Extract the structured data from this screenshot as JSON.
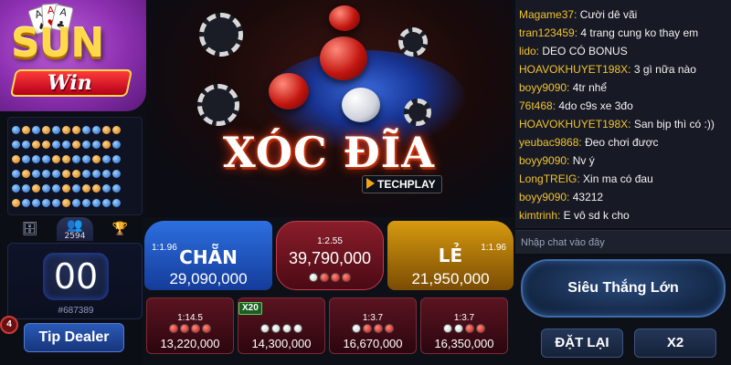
{
  "logo": {
    "brand": "SUN",
    "sub": "Win"
  },
  "colors": {
    "chan": "#2d6fe0",
    "le": "#d79a10",
    "mid": "#8a1d2a",
    "side": "#5a1420",
    "username": "#f2c230"
  },
  "history": {
    "rows": [
      [
        "b",
        "o",
        "b",
        "o",
        "b",
        "o",
        "o",
        "b",
        "b",
        "o",
        "o"
      ],
      [
        "b",
        "b",
        "o",
        "o",
        "b",
        "b",
        "o",
        "b",
        "b",
        "o",
        "b"
      ],
      [
        "o",
        "b",
        "b",
        "b",
        "o",
        "o",
        "b",
        "b",
        "o",
        "b",
        "b"
      ],
      [
        "b",
        "o",
        "b",
        "b",
        "b",
        "o",
        "o",
        "b",
        "b",
        "b",
        "b"
      ],
      [
        "b",
        "b",
        "o",
        "b",
        "b",
        "o",
        "b",
        "o",
        "o",
        "b",
        "b"
      ],
      [
        "o",
        "b",
        "b",
        "b",
        "b",
        "o",
        "b",
        "b",
        "b",
        "b",
        "b"
      ]
    ]
  },
  "tabs": {
    "players_count": "2594"
  },
  "timer": {
    "value": "00",
    "session": "#687389"
  },
  "level": "4",
  "tip_button": "Tip Dealer",
  "hero": {
    "title": "XÓC ĐĨA",
    "provider": "TECHPLAY"
  },
  "bets": {
    "chan": {
      "name": "CHẴN",
      "odds": "1:1.96",
      "amount": "29,090,000"
    },
    "mid": {
      "odds": "1:2.55",
      "amount": "39,790,000",
      "dots": [
        "w",
        "r",
        "r",
        "r"
      ]
    },
    "le": {
      "name": "LẺ",
      "odds": "1:1.96",
      "amount": "21,950,000"
    },
    "side": [
      {
        "odds": "1:14.5",
        "dots": [
          "r",
          "r",
          "r",
          "r"
        ],
        "amount": "13,220,000"
      },
      {
        "badge": "X20",
        "odds": "",
        "dots": [
          "w",
          "w",
          "w",
          "w"
        ],
        "amount": "14,300,000"
      },
      {
        "odds": "1:3.7",
        "dots": [
          "w",
          "r",
          "r",
          "r"
        ],
        "amount": "16,670,000"
      },
      {
        "odds": "1:3.7",
        "dots": [
          "w",
          "w",
          "r",
          "r"
        ],
        "amount": "16,350,000"
      }
    ]
  },
  "chat": {
    "messages": [
      {
        "user": "Magame37:",
        "text": " Cười dê vãi"
      },
      {
        "user": "tran123459:",
        "text": " 4 trang cung ko thay em"
      },
      {
        "user": "lido:",
        "text": " DEO CÓ BONUS"
      },
      {
        "user": "HOAVOKHUYET198X:",
        "text": " 3 gì nữa nào"
      },
      {
        "user": "boyy9090:",
        "text": " 4tr nhể"
      },
      {
        "user": "76t468:",
        "text": " 4do c9s xe 3đo"
      },
      {
        "user": "HOAVOKHUYET198X:",
        "text": " San bịp thì có :))"
      },
      {
        "user": "yeubac9868:",
        "text": " Đeo chơi được"
      },
      {
        "user": "boyy9090:",
        "text": " Nv ý"
      },
      {
        "user": "LongTREIG:",
        "text": " Xin ma có đau"
      },
      {
        "user": "boyy9090:",
        "text": " 43212"
      },
      {
        "user": "kimtrinh:",
        "text": " E vô sd k cho"
      }
    ],
    "placeholder": "Nhập chat vào đây"
  },
  "controls": {
    "big_win": "Siêu Thắng Lớn",
    "reset": "ĐẶT LẠI",
    "double": "X2"
  }
}
